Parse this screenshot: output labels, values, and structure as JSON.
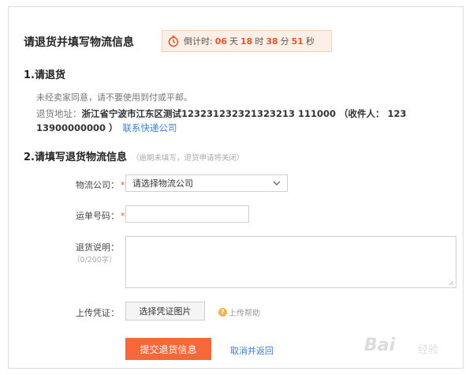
{
  "header": {
    "title": "请退货并填写物流信息",
    "countdown": {
      "label": "倒计时:",
      "days": "06",
      "days_unit": "天",
      "hours": "18",
      "hours_unit": "时",
      "minutes": "38",
      "minutes_unit": "分",
      "seconds": "51",
      "seconds_unit": "秒"
    }
  },
  "section1": {
    "title": "1.请退货",
    "notice": "未经卖家同意，请不要使用到付或平邮。",
    "address_label": "退货地址：",
    "address_value": "浙江省宁波市江东区测试123231232321323213 111000 （收件人： 123 13900000000 ）",
    "contact_link": "联系快递公司"
  },
  "section2": {
    "title": "2.请填写退货物流信息",
    "hint": "（逾期未填写，退货申请将关闭）",
    "logistics": {
      "label": "物流公司：",
      "required": "*",
      "placeholder": "请选择物流公司"
    },
    "tracking": {
      "label": "运单号码：",
      "required": "*"
    },
    "description": {
      "label": "退货说明：",
      "counter": "（0/200字）"
    },
    "upload": {
      "label": "上传凭证：",
      "button": "选择凭证图片",
      "help": "上传帮助"
    },
    "submit": "提交退货信息",
    "cancel": "取消并返回"
  },
  "watermark": {
    "brand": "Bai",
    "sub": "经验"
  },
  "colors": {
    "accent": "#f4683a",
    "link": "#3c7fd1",
    "countdown_bg": "#fdeee6",
    "countdown_num": "#e4572e"
  }
}
